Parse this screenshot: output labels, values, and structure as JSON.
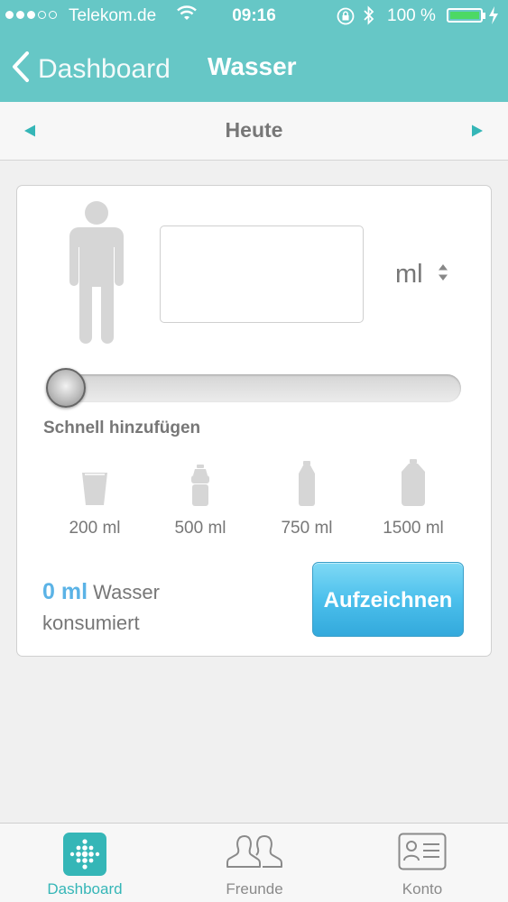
{
  "status_bar": {
    "carrier": "Telekom.de",
    "time": "09:16",
    "battery": "100 %",
    "battery_level": 1.0,
    "signal_bars_filled": 3,
    "signal_bars_total": 5
  },
  "nav": {
    "back_label": "Dashboard",
    "title": "Wasser"
  },
  "date_bar": {
    "label": "Heute"
  },
  "entry": {
    "amount_value": "",
    "unit": "ml",
    "slider_level": 0
  },
  "quick_add": {
    "label": "Schnell hinzufügen",
    "items": [
      {
        "label": "200 ml",
        "icon": "glass-icon"
      },
      {
        "label": "500 ml",
        "icon": "small-bottle-icon"
      },
      {
        "label": "750 ml",
        "icon": "medium-bottle-icon"
      },
      {
        "label": "1500 ml",
        "icon": "large-bottle-icon"
      }
    ]
  },
  "summary": {
    "amount": "0 ml",
    "text_1": "Wasser",
    "text_2": "konsumiert"
  },
  "record_button": {
    "label": "Aufzeichnen"
  },
  "tabs": [
    {
      "label": "Dashboard",
      "icon": "dashboard-icon",
      "active": true
    },
    {
      "label": "Freunde",
      "icon": "friends-icon",
      "active": false
    },
    {
      "label": "Konto",
      "icon": "account-card-icon",
      "active": false
    }
  ],
  "colors": {
    "header": "#66c7c6",
    "accent_teal": "#35b6b7",
    "accent_blue": "#5bb3e6",
    "icon_grey": "#d6d6d6"
  }
}
